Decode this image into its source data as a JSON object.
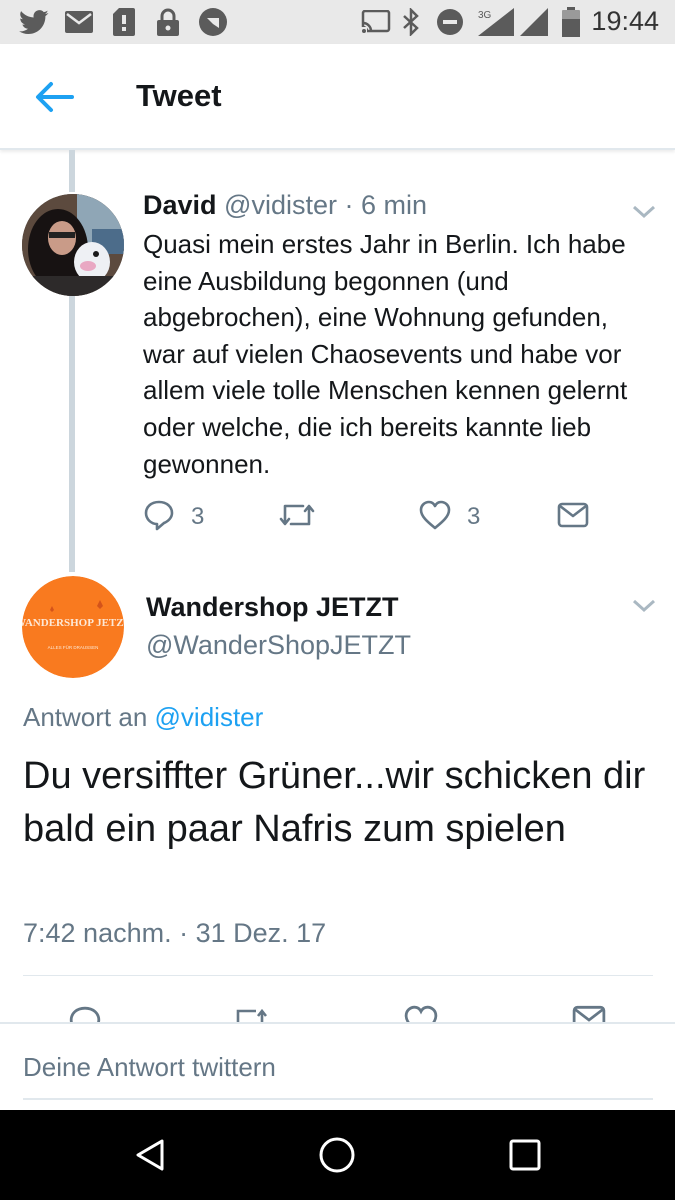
{
  "status_bar": {
    "time": "19:44",
    "network_label": "3G",
    "left_icons": [
      "twitter-icon",
      "mail-icon",
      "sd-card-icon",
      "lock-icon",
      "app-icon"
    ],
    "right_icons": [
      "cast-icon",
      "bluetooth-icon",
      "do-not-disturb-icon",
      "signal-icon",
      "signal-icon",
      "battery-icon"
    ]
  },
  "header": {
    "title": "Tweet"
  },
  "parent_tweet": {
    "name": "David",
    "handle": "@vidister",
    "separator": "·",
    "age": "6 min",
    "text": "Quasi mein erstes Jahr in Berlin. Ich habe eine Ausbildung begonnen (und abgebrochen), eine Wohnung gefunden, war auf vielen Chaosevents und habe vor allem viele tolle Menschen kennen gelernt oder welche, die ich bereits kannte lieb gewonnen.",
    "reply_count": "3",
    "like_count": "3"
  },
  "focus_tweet": {
    "name": "Wandershop JETZT",
    "handle": "@WanderShopJETZT",
    "avatar_logo_text": "WANDERSHOP JETZT",
    "avatar_logo_subtext": "ALLES FÜR DRAUSSEN",
    "reply_prefix": "Antwort an",
    "reply_to": "@vidister",
    "text": "Du versiffter Grüner...wir schicken dir bald ein paar Nafris zum spielen",
    "timestamp": "7:42 nachm. · 31 Dez. 17",
    "avatar_color": "#f97a1f"
  },
  "reply_box": {
    "placeholder": "Deine Antwort twittern"
  },
  "colors": {
    "accent": "#1da1f2",
    "muted": "#657786",
    "status_bar_bg": "#e9e9e9",
    "nav_bar_bg": "#000000"
  }
}
